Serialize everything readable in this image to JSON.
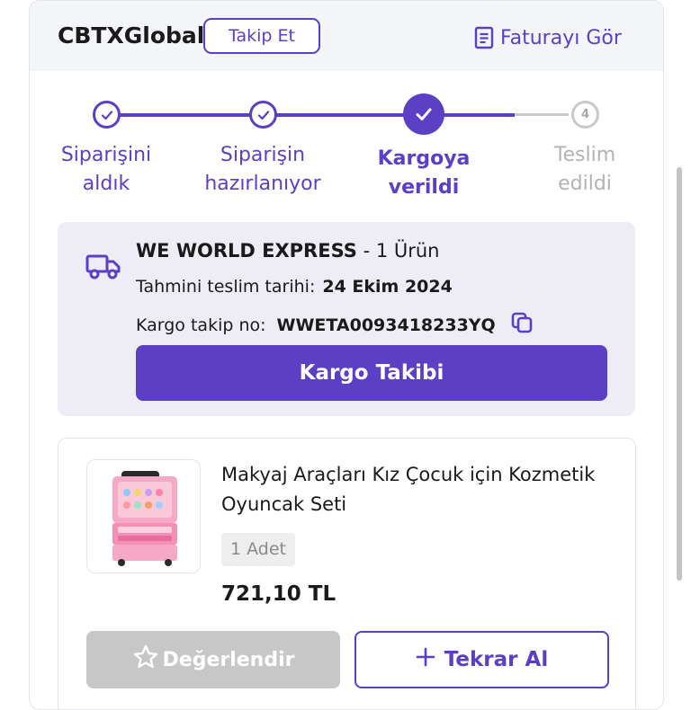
{
  "header": {
    "seller_name": "CBTXGlobal",
    "follow_label": "Takip Et",
    "invoice_label": "Faturayı Gör"
  },
  "stepper": {
    "steps": [
      {
        "line1": "Siparişini",
        "line2": "aldık",
        "state": "done"
      },
      {
        "line1": "Siparişin",
        "line2": "hazırlanıyor",
        "state": "done"
      },
      {
        "line1": "Kargoya",
        "line2": "verildi",
        "state": "current"
      },
      {
        "line1": "Teslim",
        "line2": "edildi",
        "state": "pending",
        "number": "4"
      }
    ]
  },
  "shipment": {
    "carrier": "WE WORLD EXPRESS",
    "item_count": " - 1 Ürün",
    "delivery_label": "Tahmini teslim tarihi:",
    "delivery_date": "24 Ekim 2024",
    "tracking_label": "Kargo takip no:",
    "tracking_number": "WWETA0093418233YQ",
    "track_button": "Kargo Takibi"
  },
  "product": {
    "name": "Makyaj Araçları Kız Çocuk için Kozmetik Oyuncak Seti",
    "quantity": "1 Adet",
    "price": "721,10 TL",
    "rate_button": "Değerlendir",
    "rebuy_button": "Tekrar Al"
  },
  "colors": {
    "accent": "#5b3fc4",
    "pending": "#c9c9c9",
    "disabled_button": "#c7c7c7",
    "shipment_bg": "#eeedf6"
  }
}
